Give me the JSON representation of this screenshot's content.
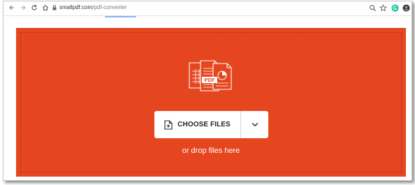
{
  "browser": {
    "url_host": "smallpdf.com",
    "url_path": "/pdf-converter"
  },
  "icons": {
    "back": "arrow-left-icon",
    "forward": "arrow-right-icon",
    "reload": "reload-icon",
    "home": "home-icon",
    "secure": "lock-icon",
    "zoom": "zoom-icon",
    "bookmark": "star-icon",
    "extension": "grammarly-icon",
    "profile": "profile-icon",
    "file": "file-plus-icon",
    "dropdown": "chevron-down-icon",
    "illustration": "documents-illustration-icon"
  },
  "colors": {
    "accent": "#e5461f",
    "button_bg": "#ffffff",
    "extension": "#15c39a"
  },
  "upload": {
    "choose_label": "CHOOSE FILES",
    "drop_text": "or drop files here",
    "pdf_badge": "PDF"
  }
}
